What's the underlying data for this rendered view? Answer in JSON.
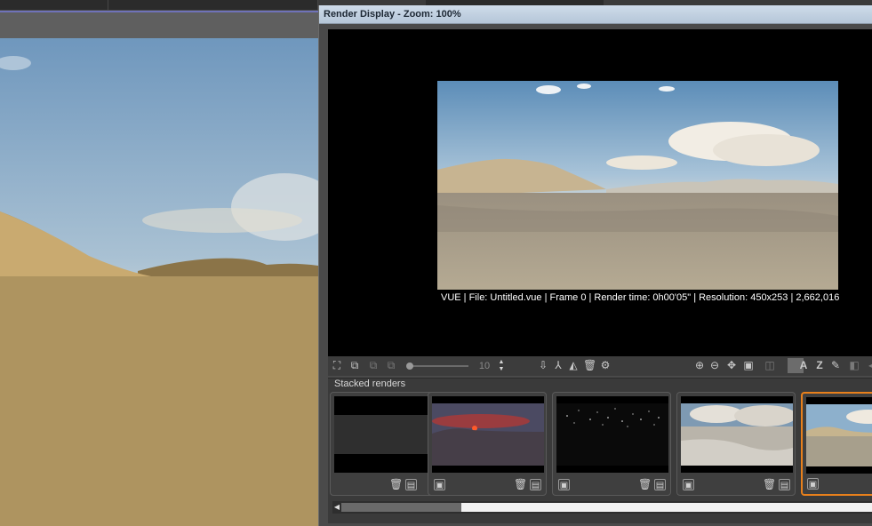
{
  "render_window": {
    "title": "Render Display - Zoom: 100%",
    "caption": "VUE | File: Untitled.vue | Frame 0 | Render time: 0h00'05\" | Resolution: 450x253 | 2,662,016 |"
  },
  "toolbar": {
    "slider_value": "10",
    "icons_left": [
      "stack-render-icon",
      "compare-icon",
      "copy-icon",
      "paste-icon"
    ],
    "icons_mid": [
      "save-icon",
      "effects-icon",
      "flip-icon",
      "delete-icon",
      "settings-icon"
    ],
    "icons_right": [
      "zoom-in-icon",
      "zoom-out-icon",
      "fit-icon",
      "display-icon",
      "channel-icon",
      "alpha-icon",
      "a-channel-icon",
      "z-channel-icon",
      "edit-icon",
      "snapshot-icon"
    ]
  },
  "stacked": {
    "label": "Stacked renders",
    "thumbs": [
      {
        "name": "blank"
      },
      {
        "name": "sunset"
      },
      {
        "name": "stars"
      },
      {
        "name": "clouds"
      },
      {
        "name": "desert"
      }
    ]
  },
  "colors": {
    "title_bar": "#b5c6d8",
    "selected_thumb": "#e8801c",
    "accent_line": "#6f72b8"
  }
}
